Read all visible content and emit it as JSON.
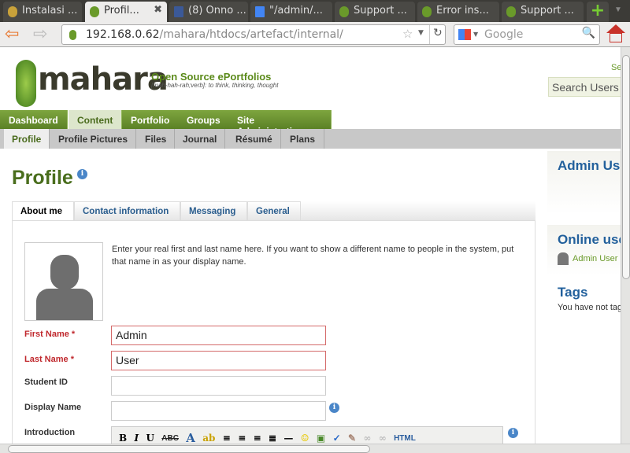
{
  "browser": {
    "tabs": [
      "Instalasi ...",
      "Profil...",
      "(8) Onno ...",
      "\"/admin/...",
      "Support ...",
      "Error ins...",
      "Support ..."
    ],
    "url_host": "192.168.0.62",
    "url_path": "/mahara/htdocs/artefact/internal/",
    "search_placeholder": "Google"
  },
  "site": {
    "logo": "mahara",
    "tagline": "Open Source ePortfolios",
    "subtagline": "[mah-hah-rah;verb]: to think, thinking, thought",
    "search_users": "Search Users",
    "corner_link": "Se"
  },
  "main_nav": [
    "Dashboard",
    "Content",
    "Portfolio",
    "Groups",
    "Site Administration"
  ],
  "sub_nav": [
    "Profile",
    "Profile Pictures",
    "Files",
    "Journal",
    "Résumé",
    "Plans"
  ],
  "page_title": "Profile",
  "profile_tabs": [
    "About me",
    "Contact information",
    "Messaging",
    "General"
  ],
  "intro_text": "Enter your real first and last name here. If you want to show a different name to people in the system, put that name in as your display name.",
  "form": {
    "first_name_label": "First Name *",
    "first_name": "Admin",
    "last_name_label": "Last Name *",
    "last_name": "User",
    "student_id_label": "Student ID",
    "student_id": "",
    "display_name_label": "Display Name",
    "display_name": "",
    "introduction_label": "Introduction"
  },
  "editor_toolbar": {
    "bold": "B",
    "italic": "I",
    "underline": "U",
    "strike": "ABC",
    "color": "A",
    "html": "HTML"
  },
  "sidebar": {
    "user_title": "Admin User",
    "online_title": "Online users",
    "online_user": "Admin User",
    "tags_title": "Tags",
    "tags_text": "You have not tagged anything yet"
  }
}
